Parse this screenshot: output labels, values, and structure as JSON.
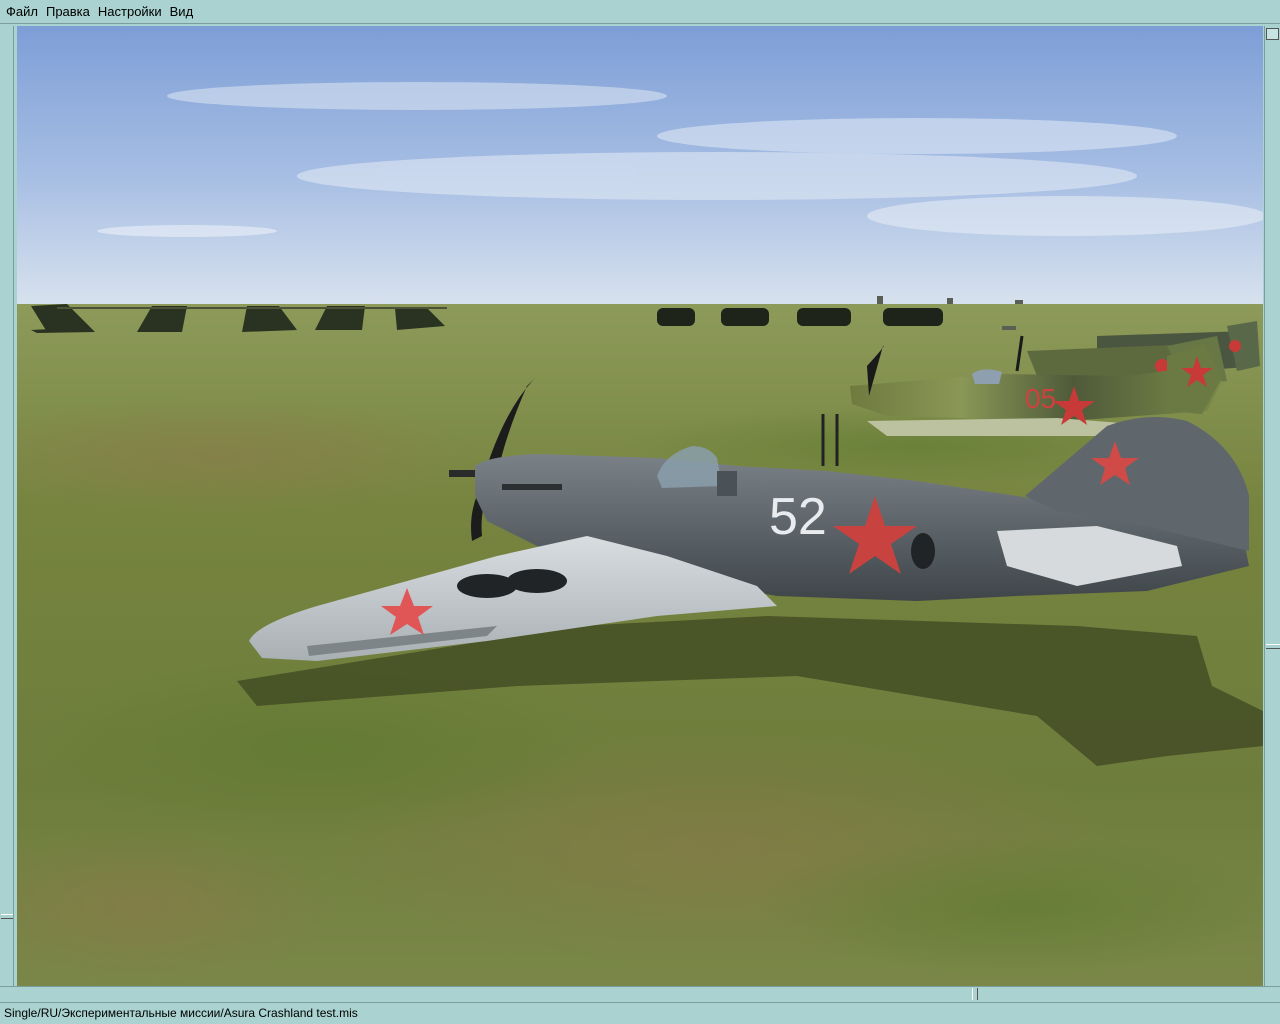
{
  "menu": {
    "items": [
      {
        "label": "Файл"
      },
      {
        "label": "Правка"
      },
      {
        "label": "Настройки"
      },
      {
        "label": "Вид"
      }
    ]
  },
  "scene": {
    "aircraft_number": "52",
    "background_aircraft_number": "05"
  },
  "statusbar": {
    "path": "Single/RU/Экспериментальные миссии/Asura  Crashland  test.mis"
  },
  "colors": {
    "chrome": "#a9d2d0",
    "sky_top": "#7e9fd6",
    "grass": "#7a8a46",
    "aircraft_grey": "#5f666b",
    "star_red": "#d84a48"
  }
}
